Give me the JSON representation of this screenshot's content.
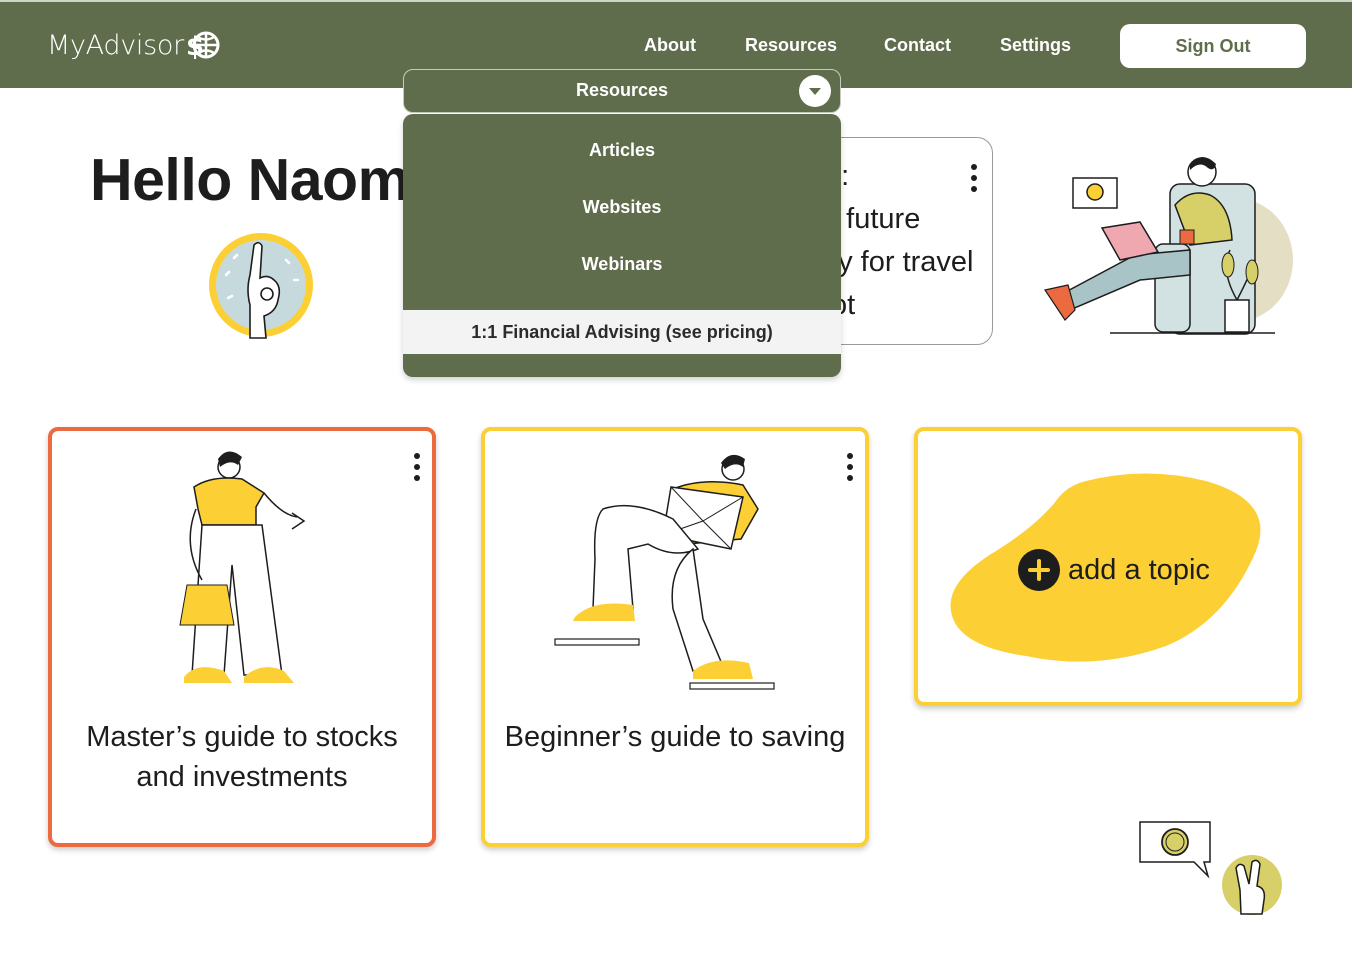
{
  "app": {
    "name": "MyAdvisor"
  },
  "nav": {
    "links": [
      "About",
      "Resources",
      "Contact",
      "Settings"
    ],
    "sign_out": "Sign Out"
  },
  "greeting": "Hello Naomi",
  "goals_card": {
    "lines": [
      "e:",
      "e future",
      "ey for travel",
      "ot"
    ]
  },
  "resources_dropdown": {
    "selected": "Resources",
    "items": [
      "Articles",
      "Websites",
      "Webinars"
    ],
    "highlighted_item": "1:1 Financial Advising (see pricing)"
  },
  "cards": [
    {
      "title_lines": [
        "Master’s guide to stocks",
        "and investments"
      ]
    },
    {
      "title_lines": [
        "Beginner’s guide to saving"
      ]
    }
  ],
  "add_topic": {
    "label": "add a topic"
  },
  "colors": {
    "primary_green": "#606d4c",
    "accent_yellow": "#fccf34",
    "accent_orange": "#ec6a40"
  },
  "icons": [
    "globe-dollar-icon",
    "chevron-down-icon",
    "kebab-menu-icon",
    "plus-icon",
    "ok-hand-icon",
    "peace-hand-icon",
    "coin-chat-icon"
  ]
}
